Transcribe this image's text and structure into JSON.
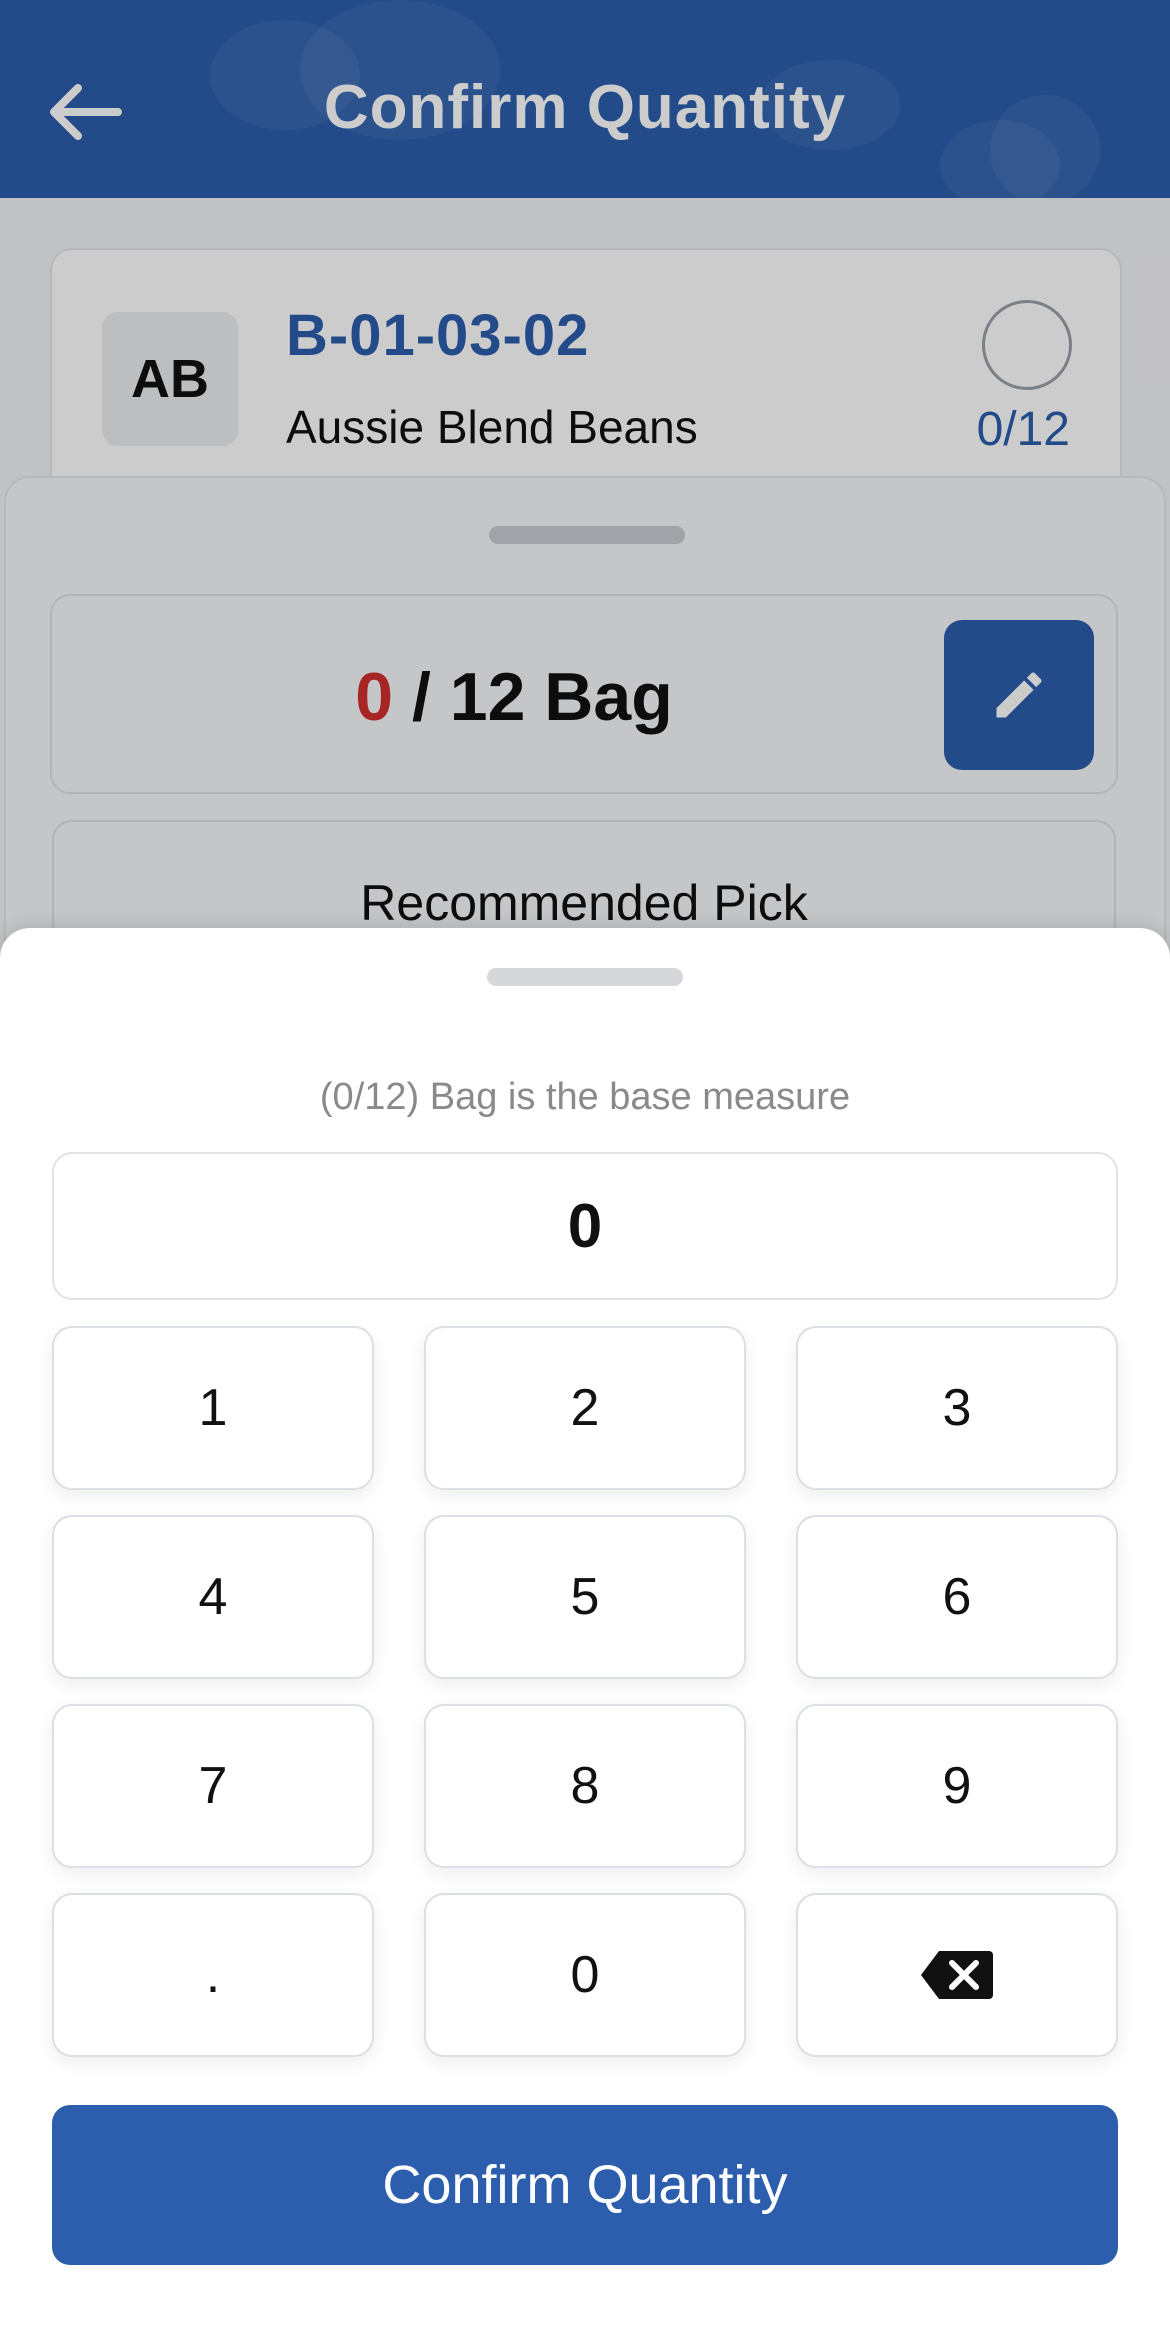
{
  "header": {
    "title": "Confirm Quantity",
    "back_icon": "arrow-left-icon",
    "background_color": "#2c5ead"
  },
  "item": {
    "avatar_initials": "AB",
    "sku": "B-01-03-02",
    "name": "Aussie Blend Beans",
    "progress": "0/12",
    "status_icon": "empty-circle-icon"
  },
  "quantity_card": {
    "current": "0",
    "rest": " / 12 Bag",
    "edit_icon": "pencil-icon",
    "current_color": "#d32f2f"
  },
  "recommended": {
    "label": "Recommended Pick"
  },
  "keypad": {
    "hint": "(0/12) Bag is the base measure",
    "display_value": "0",
    "keys": [
      "1",
      "2",
      "3",
      "4",
      "5",
      "6",
      "7",
      "8",
      "9",
      ".",
      "0"
    ],
    "backspace_icon": "backspace-icon",
    "confirm_label": "Confirm Quantity",
    "accent_color": "#2c5ead"
  }
}
